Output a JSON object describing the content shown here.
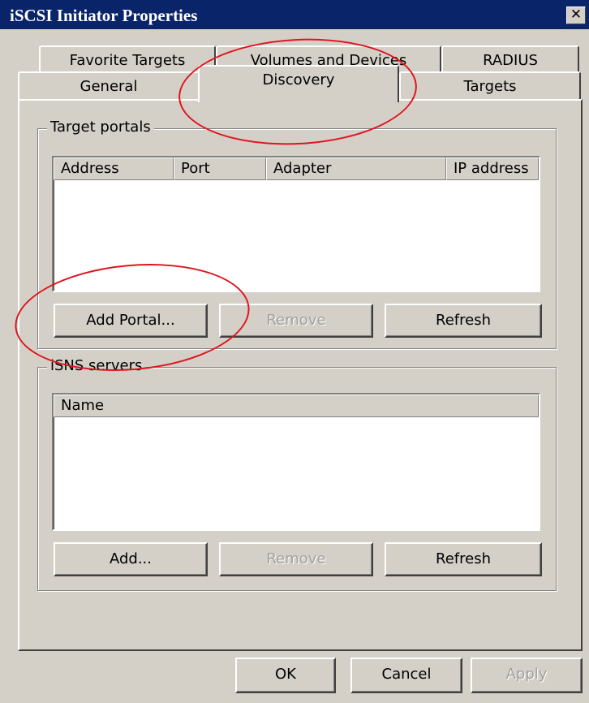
{
  "window": {
    "title": "iSCSI Initiator Properties",
    "close_glyph": "✕"
  },
  "tabs": {
    "row_back": [
      "Favorite Targets",
      "Volumes and Devices",
      "RADIUS"
    ],
    "row_front": [
      "General",
      "Discovery",
      "Targets"
    ],
    "active": "Discovery"
  },
  "target_portals": {
    "label": "Target portals",
    "columns": [
      "Address",
      "Port",
      "Adapter",
      "IP address"
    ],
    "rows": [],
    "buttons": {
      "add": "Add Portal...",
      "remove": "Remove",
      "refresh": "Refresh"
    }
  },
  "isns_servers": {
    "label": "iSNS servers",
    "columns": [
      "Name"
    ],
    "rows": [],
    "buttons": {
      "add": "Add...",
      "remove": "Remove",
      "refresh": "Refresh"
    }
  },
  "dialog_buttons": {
    "ok": "OK",
    "cancel": "Cancel",
    "apply": "Apply"
  },
  "colors": {
    "titlebar": "#0a246a",
    "face": "#d4d0c8",
    "annotation": "#e0141e"
  }
}
